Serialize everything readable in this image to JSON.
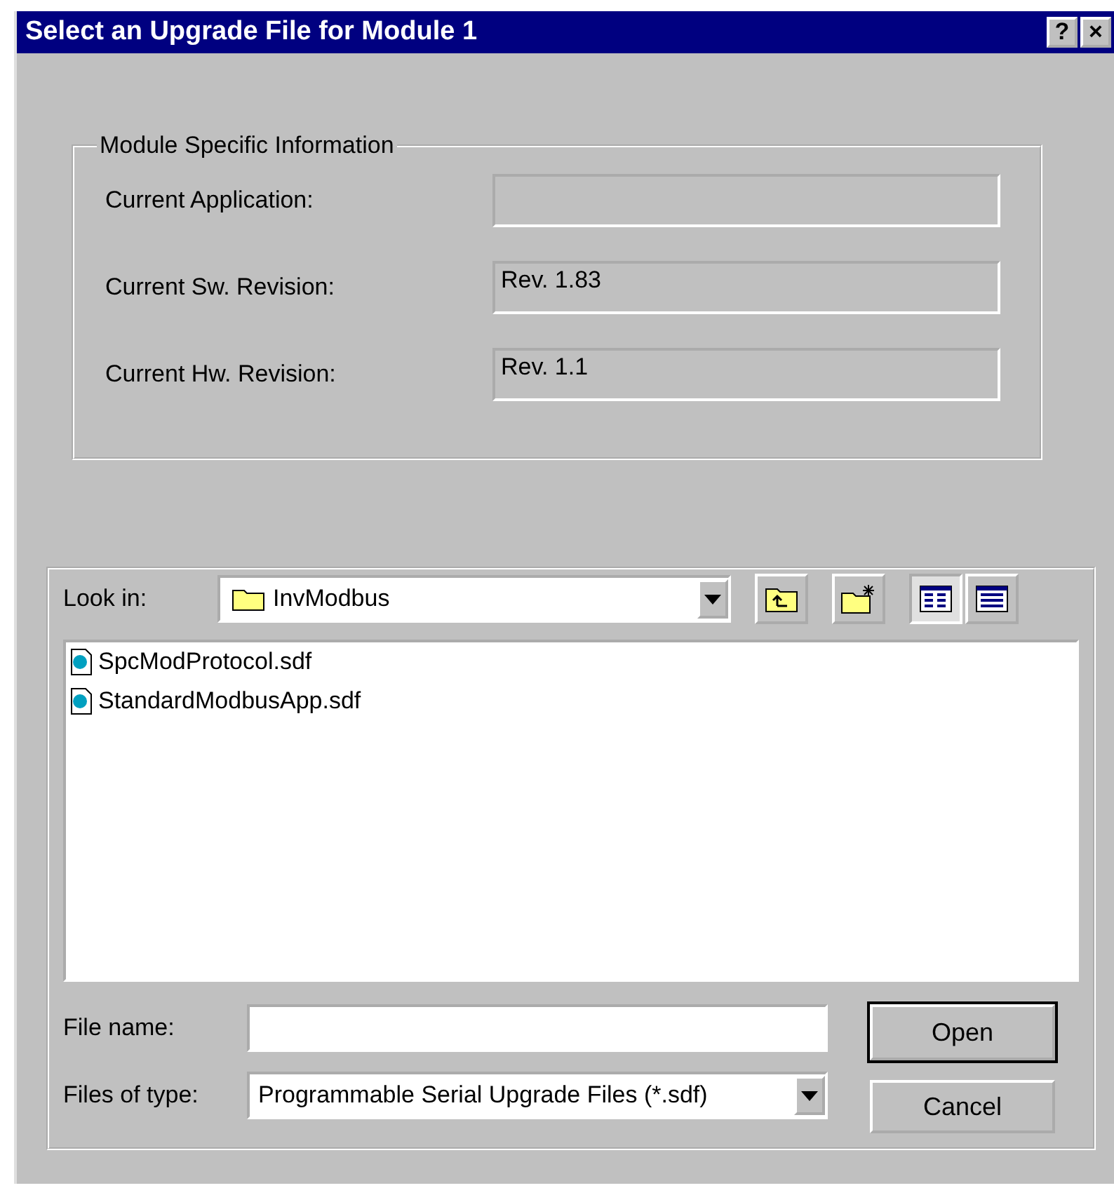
{
  "window": {
    "title": "Select an Upgrade File for Module 1",
    "title_buttons": [
      "?",
      "×"
    ]
  },
  "module_info": {
    "title": "Module Specific Information",
    "fields": [
      {
        "label": "Current Application:"
      },
      {
        "label": "Current Sw. Revision:",
        "value": "Rev. 1.83"
      },
      {
        "label": "Current Hw. Revision:",
        "value": "Rev. 1.1"
      }
    ]
  },
  "look_in": {
    "label": "Look in:",
    "value": "InvModbus"
  },
  "view_buttons": [
    {
      "kind": "list",
      "selected": true
    },
    {
      "kind": "details",
      "selected": false
    }
  ],
  "files": [
    {
      "name": "SpcModProtocol.sdf"
    },
    {
      "name": "StandardModbusApp.sdf"
    }
  ],
  "file_name": {
    "label": "File name:"
  },
  "file_type": {
    "label": "Files of type:",
    "value": "Programmable Serial Upgrade Files (*.sdf)"
  },
  "buttons": [
    {
      "label": "Open",
      "default": true
    },
    {
      "label": "Cancel",
      "default": false
    }
  ]
}
